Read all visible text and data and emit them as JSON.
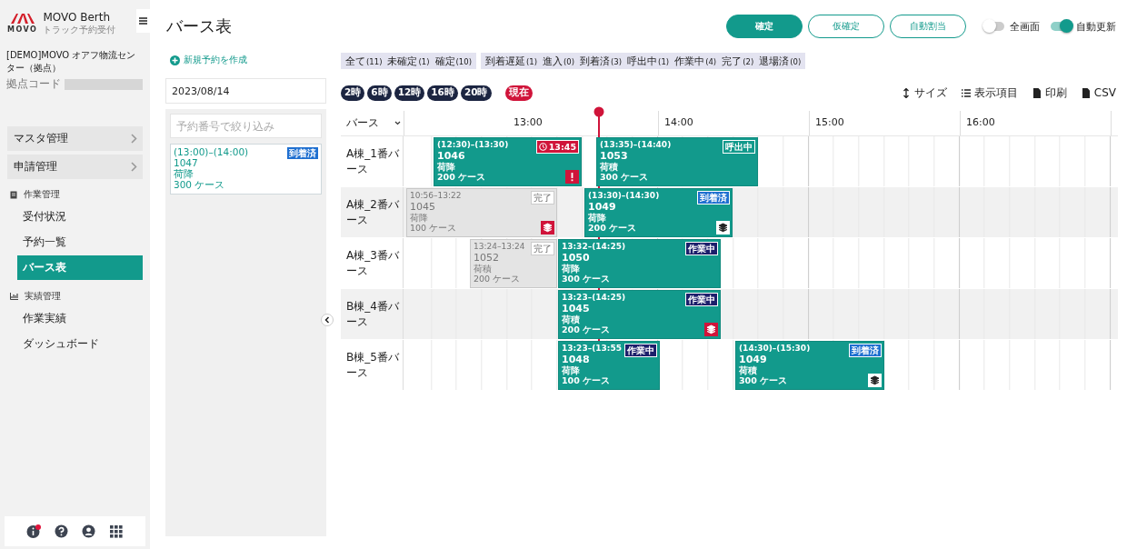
{
  "app": {
    "name": "MOVO Berth",
    "subtitle": "トラック予約受付",
    "logo_text": "MOVO"
  },
  "site": {
    "name": "[DEMO]MOVO オアフ物流センター（拠点）",
    "code_label": "拠点コード"
  },
  "menu": [
    {
      "label": "マスタ管理"
    },
    {
      "label": "申請管理"
    }
  ],
  "sections": [
    {
      "title": "作業管理",
      "kind": "work",
      "items": [
        {
          "label": "受付状況",
          "selected": false
        },
        {
          "label": "予約一覧",
          "selected": false
        },
        {
          "label": "バース表",
          "selected": true
        }
      ]
    },
    {
      "title": "実績管理",
      "kind": "chart",
      "items": [
        {
          "label": "作業実績",
          "selected": false
        },
        {
          "label": "ダッシュボード",
          "selected": false
        }
      ]
    }
  ],
  "page_title": "バース表",
  "new_booking": "新規予約を作成",
  "date": "2023/08/14",
  "search": {
    "placeholder": "予約番号で絞り込み"
  },
  "unassigned": [
    {
      "time": "(13:00)–(14:00)",
      "number": "1047",
      "type": "荷降",
      "quantity": "300 ケース",
      "badge": {
        "text": "到着済",
        "kind": "arrived"
      }
    }
  ],
  "actions": [
    {
      "label": "確定",
      "kind": "primary"
    },
    {
      "label": "仮確定",
      "kind": "outline"
    },
    {
      "label": "自動割当",
      "kind": "outline"
    }
  ],
  "toggles": [
    {
      "label": "全画面",
      "on": false
    },
    {
      "label": "自動更新",
      "on": true
    }
  ],
  "filter_groups": [
    {
      "items": [
        {
          "label": "全て",
          "count": "(11)"
        },
        {
          "label": "未確定",
          "count": "(1)"
        },
        {
          "label": "確定",
          "count": "(10)"
        }
      ]
    },
    {
      "items": [
        {
          "label": "到着遅延",
          "count": "(1)"
        },
        {
          "label": "進入",
          "count": "(0)"
        },
        {
          "label": "到着済",
          "count": "(3)"
        },
        {
          "label": "呼出中",
          "count": "(1)"
        },
        {
          "label": "作業中",
          "count": "(4)"
        },
        {
          "label": "完了",
          "count": "(2)"
        },
        {
          "label": "退場済",
          "count": "(0)"
        }
      ]
    }
  ],
  "time_chips": [
    {
      "label": "2時",
      "kind": "hour"
    },
    {
      "label": "6時",
      "kind": "hour"
    },
    {
      "label": "12時",
      "kind": "hour"
    },
    {
      "label": "16時",
      "kind": "hour"
    },
    {
      "label": "20時",
      "kind": "hour"
    },
    {
      "label": "現在",
      "kind": "now"
    }
  ],
  "tools": [
    {
      "label": "サイズ",
      "kind": "size"
    },
    {
      "label": "表示項目",
      "kind": "list"
    },
    {
      "label": "印刷",
      "kind": "print"
    },
    {
      "label": "CSV",
      "kind": "csv"
    }
  ],
  "timeline": {
    "berth_header": "バース",
    "hours": [
      "13:00",
      "14:00",
      "15:00",
      "16:00"
    ],
    "rows": [
      {
        "berth": "A棟_1番バース",
        "bookings": [
          {
            "kind": "active",
            "time": "(12:30)–(13:30)",
            "number": "1046",
            "type": "荷降",
            "quantity": "200 ケース",
            "badge": {
              "text": "13:45",
              "kind": "late"
            },
            "alert": true,
            "layered": false
          },
          {
            "kind": "active",
            "time": "(13:35)–(14:40)",
            "number": "1053",
            "type": "荷積",
            "quantity": "300 ケース",
            "badge": {
              "text": "呼出中",
              "kind": "called"
            },
            "alert": false,
            "layered": false
          }
        ]
      },
      {
        "berth": "A棟_2番バース",
        "bookings": [
          {
            "kind": "done",
            "time": "10:56–13:22",
            "number": "1045",
            "type": "荷降",
            "quantity": "100 ケース",
            "badge": {
              "text": "完了",
              "kind": "done"
            },
            "alert": false,
            "layered": true,
            "layer_warning": true
          },
          {
            "kind": "active",
            "time": "(13:30)–(14:30)",
            "number": "1049",
            "type": "荷降",
            "quantity": "200 ケース",
            "badge": {
              "text": "到着済",
              "kind": "arrived"
            },
            "alert": false,
            "layered": true,
            "layer_warning": false
          }
        ]
      },
      {
        "berth": "A棟_3番バース",
        "bookings": [
          {
            "kind": "done",
            "time": "13:24–13:24",
            "number": "1052",
            "type": "荷積",
            "quantity": "200 ケース",
            "badge": {
              "text": "完了",
              "kind": "done"
            },
            "alert": false,
            "layered": false
          },
          {
            "kind": "active",
            "time": "13:32–(14:25)",
            "number": "1050",
            "type": "荷降",
            "quantity": "300 ケース",
            "badge": {
              "text": "作業中",
              "kind": "working"
            },
            "alert": false,
            "layered": false
          }
        ]
      },
      {
        "berth": "B棟_4番バース",
        "bookings": [
          {
            "kind": "active",
            "time": "13:23–(14:25)",
            "number": "1045",
            "type": "荷積",
            "quantity": "200 ケース",
            "badge": {
              "text": "作業中",
              "kind": "working"
            },
            "alert": false,
            "layered": true,
            "layer_warning": true
          }
        ]
      },
      {
        "berth": "B棟_5番バース",
        "bookings": [
          {
            "kind": "active",
            "time": "13:23–(13:55",
            "number": "1048",
            "type": "荷降",
            "quantity": "100 ケース",
            "badge": {
              "text": "作業中",
              "kind": "working"
            },
            "alert": false,
            "layered": false
          },
          {
            "kind": "active",
            "time": "(14:30)–(15:30)",
            "number": "1049",
            "type": "荷積",
            "quantity": "300 ケース",
            "badge": {
              "text": "到着済",
              "kind": "arrived"
            },
            "alert": false,
            "layered": true,
            "layer_warning": false
          }
        ]
      }
    ]
  },
  "footer_icons": [
    {
      "kind": "info",
      "notify": true
    },
    {
      "kind": "help",
      "notify": false
    },
    {
      "kind": "user",
      "notify": false
    },
    {
      "kind": "apps",
      "notify": false
    }
  ]
}
